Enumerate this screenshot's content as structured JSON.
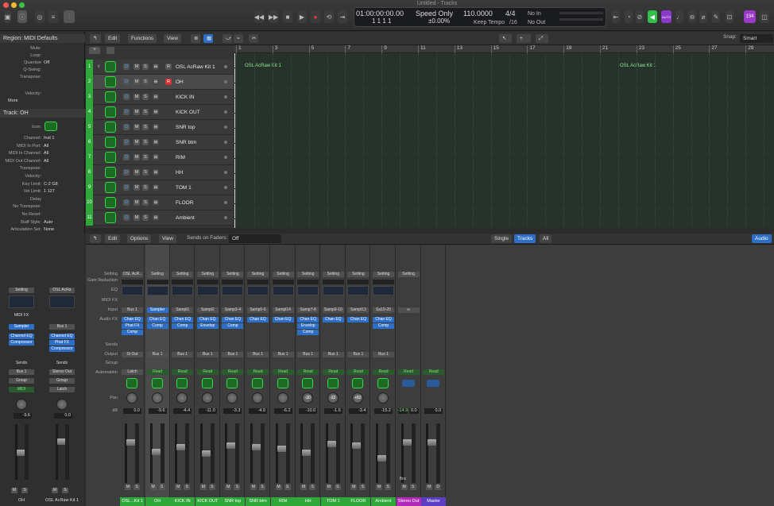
{
  "window": {
    "title": "Untitled - Tracks"
  },
  "lcd": {
    "time": "01:00:00:00.00",
    "bars": "1  1  1  1",
    "mode": "Speed Only",
    "percent": "±0.00%",
    "tempo": "110.0000",
    "tempo_mode": "Keep Tempo",
    "sig": "4/4",
    "division": "/16",
    "in": "No In",
    "out": "No Out"
  },
  "toolbar": {
    "count_badge": "‡34",
    "auto_label": "AUTO"
  },
  "inspector": {
    "region_header": "Region: MIDI Defaults",
    "region_rows": [
      {
        "label": "Mute:",
        "value": ""
      },
      {
        "label": "Loop:",
        "value": ""
      },
      {
        "label": "Quantize",
        "value": "Off"
      },
      {
        "label": "Q-Swing:",
        "value": ""
      },
      {
        "label": "Transpose:",
        "value": ""
      },
      {
        "label": "Velocity:",
        "value": ""
      }
    ],
    "more": "More",
    "track_header": "Track:  OH",
    "icon_label": "Icon:",
    "track_rows": [
      {
        "label": "Channel:",
        "value": "Inst 1"
      },
      {
        "label": "MIDI In Port:",
        "value": "All"
      },
      {
        "label": "MIDI In Channel:",
        "value": "All"
      },
      {
        "label": "MIDI Out Channel:",
        "value": "All"
      },
      {
        "label": "Transpose:",
        "value": ""
      },
      {
        "label": "Velocity:",
        "value": ""
      },
      {
        "label": "Key Limit:",
        "value": "C-2  G8"
      },
      {
        "label": "Vel Limit:",
        "value": "1  127"
      },
      {
        "label": "Delay",
        "value": ""
      },
      {
        "label": "No Transpose:",
        "value": ""
      },
      {
        "label": "No Reset:",
        "value": ""
      },
      {
        "label": "Staff Style:",
        "value": "Auto"
      },
      {
        "label": "Articulation Set:",
        "value": "None"
      }
    ]
  },
  "editbar": {
    "edit": "Edit",
    "functions": "Functions",
    "view": "View",
    "snap_label": "Snap:",
    "snap_value": "Smart"
  },
  "ruler": [
    "1",
    "3",
    "5",
    "7",
    "9",
    "11",
    "13",
    "15",
    "17",
    "19",
    "21",
    "23",
    "25",
    "27",
    "29"
  ],
  "tracks": [
    {
      "num": "1",
      "name": "OSL AcRaw Kit 1"
    },
    {
      "num": "2",
      "name": "OH"
    },
    {
      "num": "3",
      "name": "KICK IN"
    },
    {
      "num": "4",
      "name": "KICK OUT"
    },
    {
      "num": "5",
      "name": "SNR top"
    },
    {
      "num": "6",
      "name": "SNR btm"
    },
    {
      "num": "7",
      "name": "RIM"
    },
    {
      "num": "8",
      "name": "HH"
    },
    {
      "num": "9",
      "name": "TOM 1"
    },
    {
      "num": "10",
      "name": "FLOOR"
    },
    {
      "num": "11",
      "name": "Ambient"
    }
  ],
  "regions": [
    {
      "label": "OSL AcRaw Kit 1"
    },
    {
      "label": "OSL AcRaw Kit 1"
    }
  ],
  "mixbar": {
    "edit": "Edit",
    "options": "Options",
    "view": "View",
    "sends_label": "Sends on Faders:",
    "sends_value": "Off",
    "single": "Single",
    "tracks": "Tracks",
    "all": "All",
    "audio": "Audio"
  },
  "mixer_row_labels": [
    "Setting",
    "Gain Reduction",
    "EQ",
    "MIDI FX",
    "Input",
    "Audio FX",
    "Sends",
    "Output",
    "Group",
    "Automation",
    "Pan",
    "dB"
  ],
  "left_strips": [
    {
      "setting": "Setting",
      "midifx": "MIDI FX",
      "input": "Sampler",
      "fx": [
        "Channel EQ",
        "Compressor"
      ],
      "sends": "Sends",
      "output": "Bus 1",
      "group": "Group",
      "auto": "MIDI",
      "db": "-9.6",
      "name": "OH"
    },
    {
      "setting": "OSL AcRa",
      "midifx": "",
      "input": "Bus 1",
      "fx": [
        "Channel EQ",
        "Phat FX",
        "Compressor"
      ],
      "sends": "Sends",
      "output": "Stereo Out",
      "group": "Group",
      "auto": "Latch",
      "db": "0.0",
      "name": "OSL AcRaw Kit 1"
    }
  ],
  "strips": [
    {
      "setting": "OSL AcR..",
      "input": "Bus 1",
      "fx": [
        "Chan EQ",
        "Phat FX",
        "Comp"
      ],
      "output": "St Out",
      "auto": "Latch",
      "db": "0.0",
      "name": "OSL...Kit 1"
    },
    {
      "setting": "Setting",
      "input": "Sampler",
      "fx": [
        "Chan EQ",
        "Comp"
      ],
      "output": "Bus 1",
      "auto": "Read",
      "db": "-9.6",
      "name": "OH"
    },
    {
      "setting": "Setting",
      "input": "Sampl1",
      "fx": [
        "Chan EQ",
        "Comp"
      ],
      "output": "Bus 1",
      "auto": "Read",
      "db": "-4.4",
      "name": "KICK IN"
    },
    {
      "setting": "Setting",
      "input": "Sampl2",
      "fx": [
        "Chan EQ",
        "Envelop"
      ],
      "output": "Bus 1",
      "auto": "Read",
      "db": "-11.0",
      "name": "KICK OUT"
    },
    {
      "setting": "Setting",
      "input": "Samp3-4",
      "fx": [
        "Chan EQ",
        "Comp"
      ],
      "output": "Bus 1",
      "auto": "Read",
      "db": "-3.3",
      "name": "SNR top"
    },
    {
      "setting": "Setting",
      "input": "Samp5-6",
      "fx": [
        "Chan EQ"
      ],
      "output": "Bus 1",
      "auto": "Read",
      "db": "-4.9",
      "name": "SNR btm"
    },
    {
      "setting": "Setting",
      "input": "Sampl14",
      "fx": [
        "Chan EQ"
      ],
      "output": "Bus 1",
      "auto": "Read",
      "db": "-6.2",
      "name": "RIM"
    },
    {
      "setting": "Setting",
      "input": "Samp7-8",
      "fx": [
        "Chan EQ",
        "Envelop",
        "Comp"
      ],
      "output": "Bus 1",
      "auto": "Read",
      "db": "-10.0",
      "name": "HH"
    },
    {
      "setting": "Setting",
      "input": "Samp9-10",
      "fx": [
        "Chan EQ"
      ],
      "output": "Bus 1",
      "auto": "Read",
      "db": "-1.6",
      "name": "TOM 1"
    },
    {
      "setting": "Setting",
      "input": "Sampl13",
      "fx": [
        "Chan EQ"
      ],
      "output": "Bus 1",
      "auto": "Read",
      "db": "-3.4",
      "name": "FLOOR"
    },
    {
      "setting": "Setting",
      "input": "Sa19-20",
      "fx": [
        "Chan EQ",
        "Comp"
      ],
      "output": "Bus 1",
      "auto": "Read",
      "db": "-15.2",
      "name": "Ambient"
    },
    {
      "setting": "Setting",
      "input": "",
      "fx": [],
      "output": "",
      "auto": "Read",
      "db": "0.0",
      "peak": "-14.9",
      "name": "Stereo Out",
      "color": "#b32ab8"
    },
    {
      "setting": "",
      "input": "",
      "fx": [],
      "output": "",
      "auto": "Read",
      "db": "0.0",
      "name": "Master",
      "color": "#5b3ec2"
    }
  ],
  "pan_values": {
    "hh": "-20",
    "tom": "-22",
    "floor": "+52"
  },
  "bnc": "Bnc"
}
